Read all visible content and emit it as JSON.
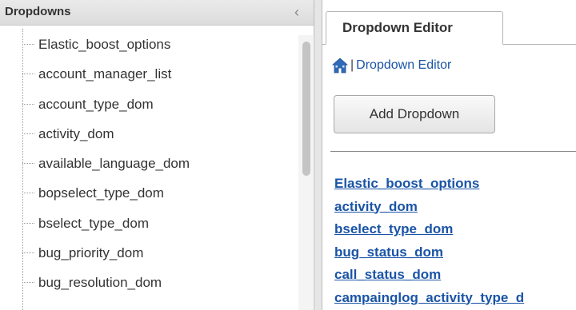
{
  "left_panel": {
    "title": "Dropdowns",
    "collapse_glyph": "‹",
    "items": [
      {
        "label": "Elastic_boost_options"
      },
      {
        "label": "account_manager_list"
      },
      {
        "label": "account_type_dom"
      },
      {
        "label": "activity_dom"
      },
      {
        "label": "available_language_dom"
      },
      {
        "label": "bopselect_type_dom"
      },
      {
        "label": "bselect_type_dom"
      },
      {
        "label": "bug_priority_dom"
      },
      {
        "label": "bug_resolution_dom"
      }
    ]
  },
  "right_panel": {
    "tab_label": "Dropdown Editor",
    "breadcrumb": {
      "separator": "|",
      "link": "Dropdown Editor"
    },
    "add_button_label": "Add Dropdown",
    "links": [
      "Elastic_boost_options",
      "activity_dom",
      "bselect_type_dom",
      "bug_status_dom",
      "call_status_dom",
      "campainglog_activity_type_d"
    ]
  },
  "icons": {
    "home": "home-icon",
    "collapse": "chevron-left-icon"
  },
  "colors": {
    "link": "#1a54a6",
    "header_bg": "#e2e2e2",
    "home_icon": "#2f6bb8"
  }
}
